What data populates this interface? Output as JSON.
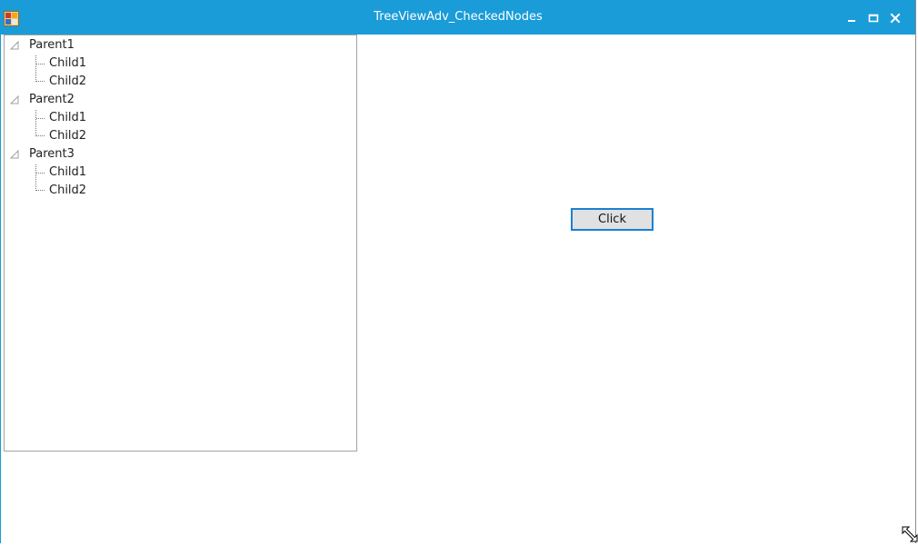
{
  "window": {
    "title": "TreeViewAdv_CheckedNodes",
    "controls": {
      "minimize": "minimize-icon",
      "maximize": "maximize-icon",
      "close": "close-icon"
    },
    "accent_color": "#1a9cd8"
  },
  "tree": {
    "nodes": [
      {
        "label": "Parent1",
        "children": [
          {
            "label": "Child1"
          },
          {
            "label": "Child2"
          }
        ]
      },
      {
        "label": "Parent2",
        "children": [
          {
            "label": "Child1"
          },
          {
            "label": "Child2"
          }
        ]
      },
      {
        "label": "Parent3",
        "children": [
          {
            "label": "Child1"
          },
          {
            "label": "Child2"
          }
        ]
      }
    ]
  },
  "button": {
    "label": "Click"
  }
}
